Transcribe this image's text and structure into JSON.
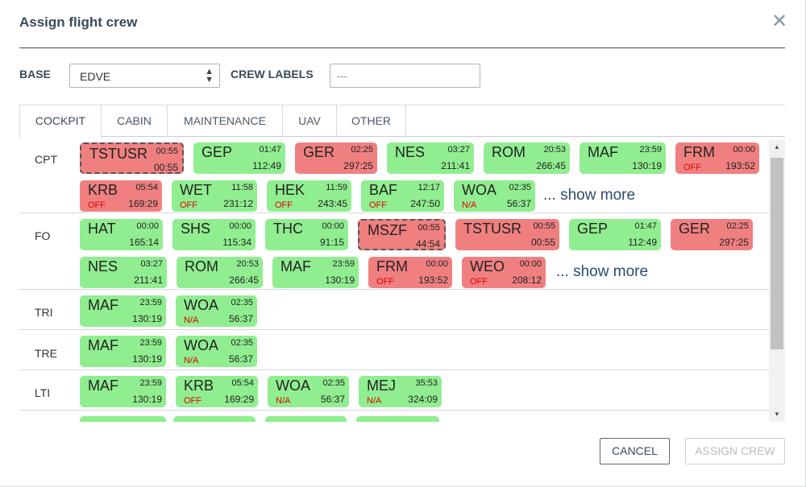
{
  "dialog": {
    "title": "Assign flight crew",
    "close_glyph": "✕"
  },
  "filters": {
    "base_label": "BASE",
    "base_value": "EDVE",
    "crew_labels_label": "CREW LABELS",
    "crew_labels_placeholder": "---"
  },
  "tabs": [
    "COCKPIT",
    "CABIN",
    "MAINTENANCE",
    "UAV",
    "OTHER"
  ],
  "active_tab": "COCKPIT",
  "show_more_label": "... show more",
  "rows": [
    {
      "label": "CPT",
      "chips": [
        {
          "code": "TSTUSR",
          "t1": "00:55",
          "t2": "00:55",
          "status": "",
          "color": "red",
          "selected": true
        },
        {
          "code": "GEP",
          "t1": "01:47",
          "t2": "112:49",
          "status": "",
          "color": "green"
        },
        {
          "code": "GER",
          "t1": "02:25",
          "t2": "297:25",
          "status": "",
          "color": "red"
        },
        {
          "code": "NES",
          "t1": "03:27",
          "t2": "211:41",
          "status": "",
          "color": "green"
        },
        {
          "code": "ROM",
          "t1": "20:53",
          "t2": "266:45",
          "status": "",
          "color": "green"
        },
        {
          "code": "MAF",
          "t1": "23:59",
          "t2": "130:19",
          "status": "",
          "color": "green"
        },
        {
          "code": "FRM",
          "t1": "00:00",
          "t2": "193:52",
          "status": "OFF",
          "color": "red"
        },
        {
          "code": "KRB",
          "t1": "05:54",
          "t2": "169:29",
          "status": "OFF",
          "color": "red"
        },
        {
          "code": "WET",
          "t1": "11:58",
          "t2": "231:12",
          "status": "OFF",
          "color": "green"
        },
        {
          "code": "HEK",
          "t1": "11:59",
          "t2": "243:45",
          "status": "OFF",
          "color": "green"
        },
        {
          "code": "BAF",
          "t1": "12:17",
          "t2": "247:50",
          "status": "OFF",
          "color": "green"
        },
        {
          "code": "WOA",
          "t1": "02:35",
          "t2": "56:37",
          "status": "N/A",
          "color": "green"
        }
      ]
    },
    {
      "label": "FO",
      "chips": [
        {
          "code": "HAT",
          "t1": "00:00",
          "t2": "165:14",
          "status": "",
          "color": "green"
        },
        {
          "code": "SHS",
          "t1": "00:00",
          "t2": "115:34",
          "status": "",
          "color": "green"
        },
        {
          "code": "THC",
          "t1": "00:00",
          "t2": "91:15",
          "status": "",
          "color": "green"
        },
        {
          "code": "MSZF",
          "t1": "00:55",
          "t2": "44:54",
          "status": "",
          "color": "red",
          "selected": true
        },
        {
          "code": "TSTUSR",
          "t1": "00:55",
          "t2": "00:55",
          "status": "",
          "color": "red"
        },
        {
          "code": "GEP",
          "t1": "01:47",
          "t2": "112:49",
          "status": "",
          "color": "green"
        },
        {
          "code": "GER",
          "t1": "02:25",
          "t2": "297:25",
          "status": "",
          "color": "red"
        },
        {
          "code": "NES",
          "t1": "03:27",
          "t2": "211:41",
          "status": "",
          "color": "green"
        },
        {
          "code": "ROM",
          "t1": "20:53",
          "t2": "266:45",
          "status": "",
          "color": "green"
        },
        {
          "code": "MAF",
          "t1": "23:59",
          "t2": "130:19",
          "status": "",
          "color": "green"
        },
        {
          "code": "FRM",
          "t1": "00:00",
          "t2": "193:52",
          "status": "OFF",
          "color": "red"
        },
        {
          "code": "WEO",
          "t1": "00:00",
          "t2": "208:12",
          "status": "OFF",
          "color": "red"
        }
      ]
    },
    {
      "label": "TRI",
      "chips": [
        {
          "code": "MAF",
          "t1": "23:59",
          "t2": "130:19",
          "status": "",
          "color": "green"
        },
        {
          "code": "WOA",
          "t1": "02:35",
          "t2": "56:37",
          "status": "N/A",
          "color": "green"
        }
      ]
    },
    {
      "label": "TRE",
      "chips": [
        {
          "code": "MAF",
          "t1": "23:59",
          "t2": "130:19",
          "status": "",
          "color": "green"
        },
        {
          "code": "WOA",
          "t1": "02:35",
          "t2": "56:37",
          "status": "N/A",
          "color": "green"
        }
      ]
    },
    {
      "label": "LTI",
      "chips": [
        {
          "code": "MAF",
          "t1": "23:59",
          "t2": "130:19",
          "status": "",
          "color": "green"
        },
        {
          "code": "KRB",
          "t1": "05:54",
          "t2": "169:29",
          "status": "OFF",
          "color": "green"
        },
        {
          "code": "WOA",
          "t1": "02:35",
          "t2": "56:37",
          "status": "N/A",
          "color": "green"
        },
        {
          "code": "MEJ",
          "t1": "35:53",
          "t2": "324:09",
          "status": "N/A",
          "color": "green"
        }
      ]
    }
  ],
  "buttons": {
    "cancel": "CANCEL",
    "assign": "ASSIGN CREW"
  },
  "colors": {
    "chip_green": "#90ee90",
    "chip_red": "#f08080",
    "status_text": "#e00000",
    "heading": "#3a4a5c"
  }
}
